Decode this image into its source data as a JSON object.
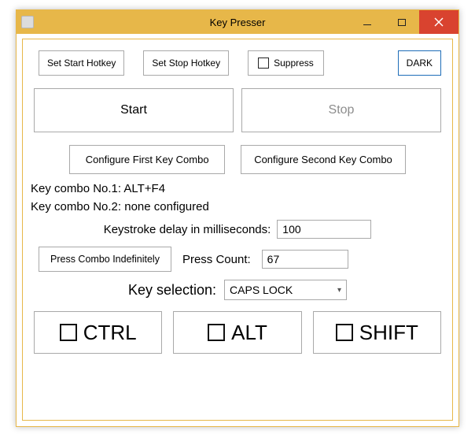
{
  "window": {
    "title": "Key Presser"
  },
  "toolbar": {
    "set_start": "Set Start Hotkey",
    "set_stop": "Set Stop Hotkey",
    "suppress": "Suppress",
    "dark": "DARK"
  },
  "actions": {
    "start": "Start",
    "stop": "Stop"
  },
  "config": {
    "first": "Configure First Key Combo",
    "second": "Configure Second Key Combo"
  },
  "combo1_label": "Key combo No.1: ALT+F4",
  "combo2_label": "Key combo No.2: none configured",
  "delay": {
    "label": "Keystroke delay in milliseconds:",
    "value": "100"
  },
  "press": {
    "indef_btn": "Press Combo Indefinitely",
    "count_label": "Press Count:",
    "count_value": "67"
  },
  "keysel": {
    "label": "Key selection:",
    "value": "CAPS LOCK"
  },
  "mods": {
    "ctrl": "CTRL",
    "alt": "ALT",
    "shift": "SHIFT"
  }
}
